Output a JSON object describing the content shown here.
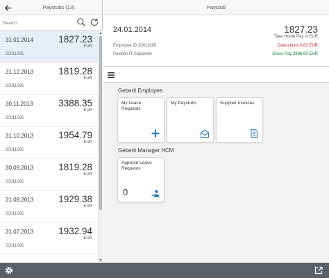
{
  "master": {
    "title": "Paystubs (13)",
    "search_placeholder": "Search",
    "items": [
      {
        "date": "31.01.2014",
        "amount": "1827.23",
        "currency": "EUR",
        "employee": "20011095"
      },
      {
        "date": "31.12.2013",
        "amount": "1819.28",
        "currency": "EUR",
        "employee": "20011095"
      },
      {
        "date": "30.11.2013",
        "amount": "3388.35",
        "currency": "EUR",
        "employee": "20011095"
      },
      {
        "date": "31.10.2013",
        "amount": "1954.79",
        "currency": "EUR",
        "employee": "20011095"
      },
      {
        "date": "30.09.2013",
        "amount": "1819.28",
        "currency": "EUR",
        "employee": "20011095"
      },
      {
        "date": "31.08.2013",
        "amount": "1929.38",
        "currency": "EUR",
        "employee": "20011095"
      },
      {
        "date": "31.07.2013",
        "amount": "1932.94",
        "currency": "EUR",
        "employee": "20011095"
      },
      {
        "date": "",
        "amount": "",
        "currency": "",
        "employee": ""
      }
    ]
  },
  "detail": {
    "title": "Paystub",
    "header": {
      "date": "24.01.2014",
      "amount": "1827.23",
      "amount_label": "Take Home Pay in EUR",
      "employee_id": "Employee ID 20011095",
      "position": "Position IT Supporter",
      "deductions": "Deductions 0.00 EUR",
      "gross_pay": "Gross Pay 2906.00 EUR"
    }
  },
  "launchpad": {
    "groups": [
      {
        "title": "Geberit Employee",
        "tiles": [
          {
            "title": "My Leave Requests",
            "icon": "add-icon"
          },
          {
            "title": "My Paystubs",
            "icon": "envelope-open-icon"
          },
          {
            "title": "Supplier Invoices",
            "icon": "invoice-document-icon"
          }
        ]
      },
      {
        "title": "Geberit Manager HCM",
        "tiles": [
          {
            "title": "Approve Leave Requests",
            "number": "0",
            "icon": "person-approve-icon"
          }
        ]
      }
    ]
  },
  "colors": {
    "accent": "#2b7cc0",
    "selected_row": "#e6eff8",
    "negative": "#cc1919",
    "positive": "#007833",
    "footer": "#5b6068"
  }
}
